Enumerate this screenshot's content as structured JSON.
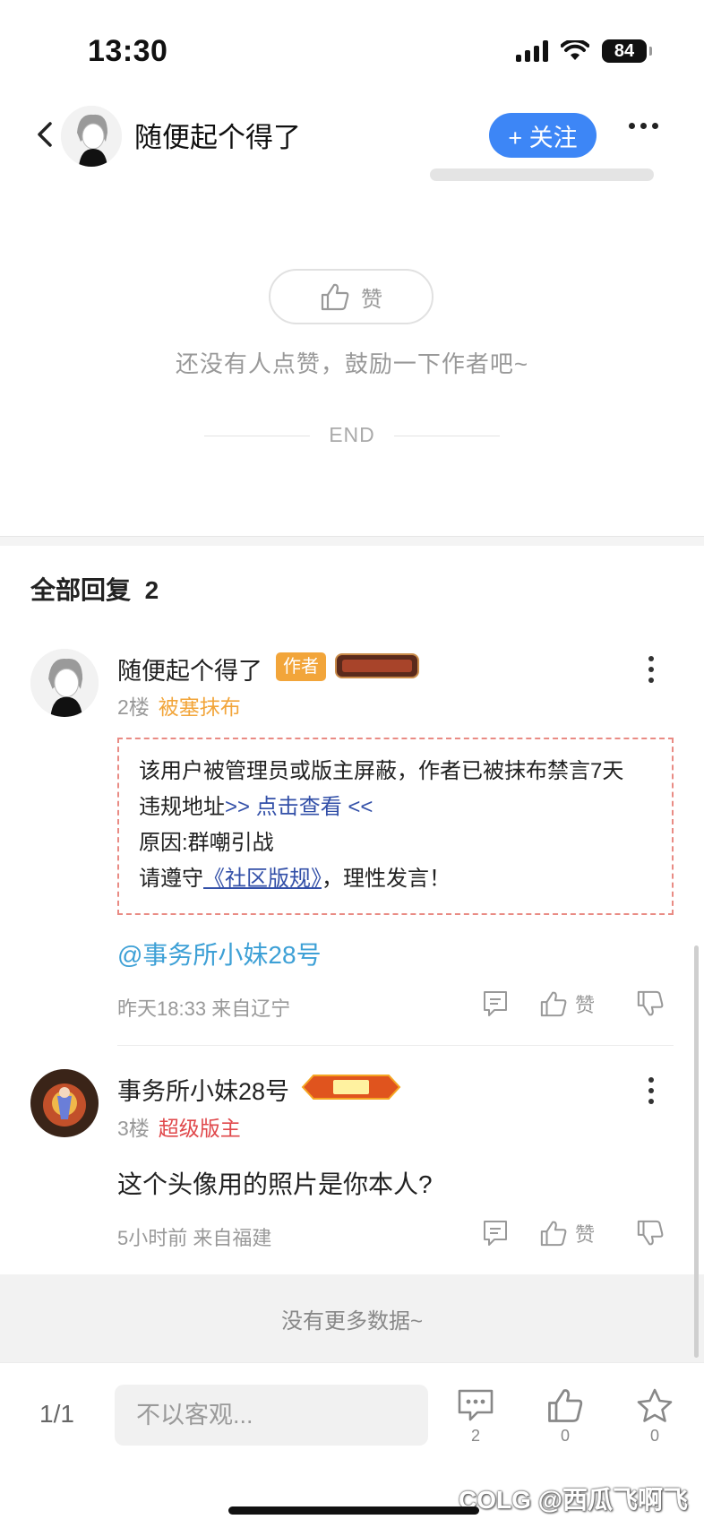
{
  "status_bar": {
    "time": "13:30",
    "battery": "84"
  },
  "header": {
    "username": "随便起个得了",
    "follow_label": "+ 关注"
  },
  "post_footer": {
    "like_label": "赞",
    "like_hint": "还没有人点赞，鼓励一下作者吧~",
    "end_label": "END"
  },
  "replies": {
    "title": "全部回复",
    "count": "2",
    "items": [
      {
        "username": "随便起个得了",
        "author_badge": "作者",
        "medal": "最强实MC",
        "floor": "2楼",
        "level": "被塞抹布",
        "ban_notice": {
          "line1": "该用户被管理员或版主屏蔽，作者已被抹布禁言7天",
          "line2_prefix": "违规地址",
          "line2_link": ">> 点击查看 <<",
          "line3": "原因:群嘲引战",
          "line4_prefix": "请遵守",
          "line4_link": "《社区版规》",
          "line4_suffix": "，理性发言！"
        },
        "mention": "@事务所小妹28号",
        "time": "昨天18:33",
        "location": "来自辽宁",
        "like_label": "赞"
      },
      {
        "username": "事务所小妹28号",
        "medal": "正义",
        "floor": "3楼",
        "level": "超级版主",
        "text": "这个头像用的照片是你本人?",
        "time": "5小时前",
        "location": "来自福建",
        "like_label": "赞"
      }
    ],
    "no_more": "没有更多数据~"
  },
  "bottom_bar": {
    "page": "1/1",
    "input_placeholder": "不以客观...",
    "comment_count": "2",
    "like_count": "0",
    "favorite_count": "0"
  },
  "watermark": "COLG @西瓜飞啊飞",
  "colors": {
    "accent_blue": "#3d86f6",
    "author_badge": "#f2a53a",
    "level_orange": "#f2a53a",
    "level_red": "#e0484b",
    "mention_blue": "#3da0d6",
    "ban_border": "#e98b84"
  }
}
